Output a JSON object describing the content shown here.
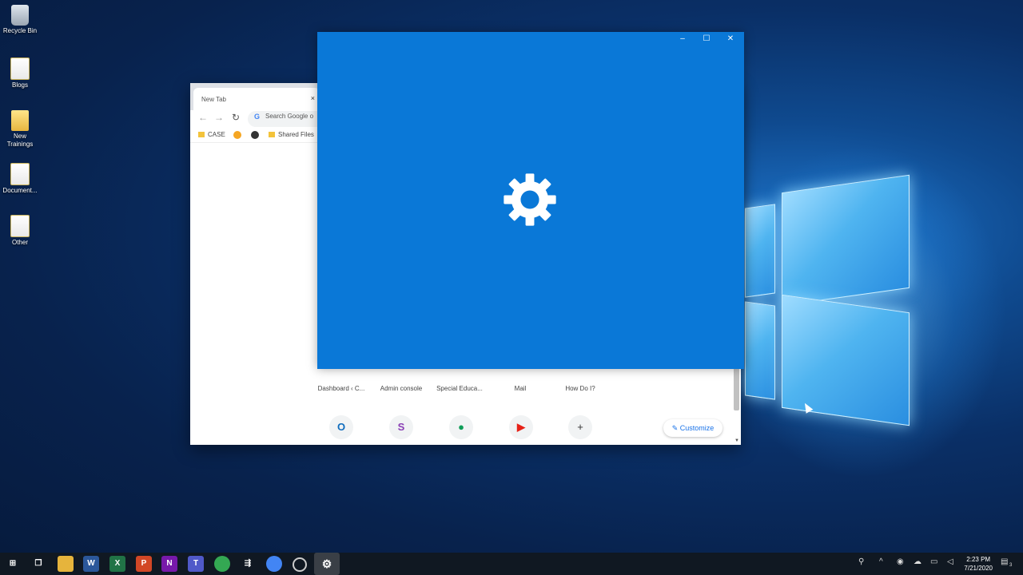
{
  "desktop": {
    "icons": [
      {
        "label": "Recycle Bin",
        "icon": "recycle-bin-icon"
      },
      {
        "label": "Blogs",
        "icon": "folder-icon"
      },
      {
        "label": "New Trainings",
        "icon": "folder-icon"
      },
      {
        "label": "Document...",
        "icon": "folder-icon"
      },
      {
        "label": "Other",
        "icon": "folder-icon"
      }
    ]
  },
  "chrome": {
    "tab_title": "New Tab",
    "tab_close": "×",
    "omnibox_placeholder": "Search Google o",
    "bookmarks": [
      "CASE",
      "Shared Files"
    ],
    "tiles": [
      "Dashboard ‹ C...",
      "Admin console",
      "Special Educa...",
      "Mail",
      "How Do I?"
    ],
    "shortcuts": [
      "outlook-icon",
      "screencastify-icon",
      "hangouts-chat-icon",
      "youtube-icon",
      "add-shortcut-icon"
    ],
    "add_shortcut": "+",
    "customize_label": "Customize"
  },
  "settings_window": {
    "minimize": "–",
    "maximize": "☐",
    "close": "✕",
    "background": "#0a78d7",
    "icon": "gear-icon"
  },
  "taskbar": {
    "apps": [
      "start-icon",
      "task-view-icon",
      "file-explorer-icon",
      "word-icon",
      "excel-icon",
      "powerpoint-icon",
      "onenote-icon",
      "teams-icon",
      "chrome-icon",
      "app-icon",
      "chrome-icon",
      "obs-icon",
      "settings-icon"
    ],
    "time": "2:23 PM",
    "date": "7/21/2020",
    "notification_count": "3"
  }
}
